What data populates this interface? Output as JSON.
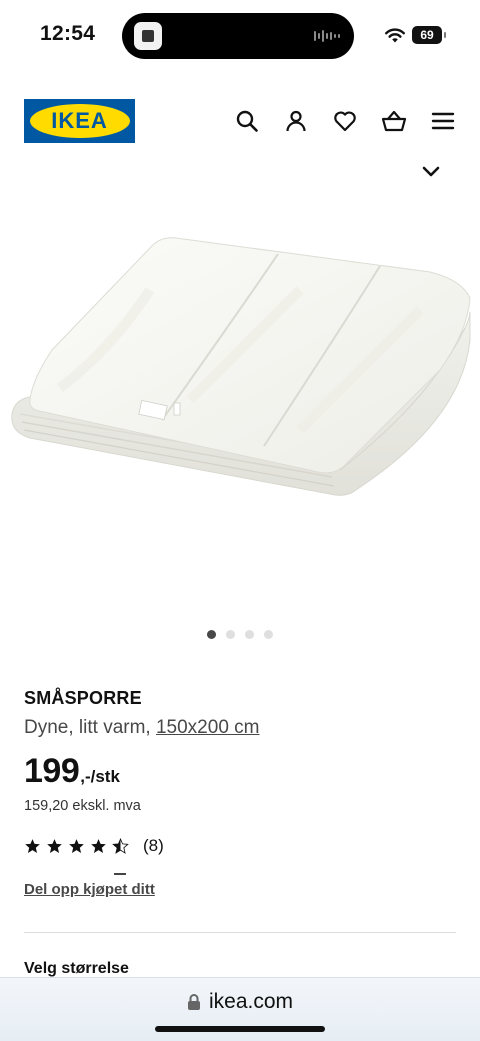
{
  "status_bar": {
    "time": "12:54",
    "battery": "69"
  },
  "header": {
    "logo_text": "IKEA",
    "icons": [
      "search-icon",
      "account-icon",
      "heart-icon",
      "basket-icon",
      "menu-icon"
    ]
  },
  "product": {
    "image_icon": "duvet-image",
    "carousel_count": 4,
    "carousel_active_index": 0,
    "name": "SMÅSPORRE",
    "description": "Dyne, litt varm,",
    "size": "150x200 cm",
    "price": "199",
    "price_unit": ",-/stk",
    "price_ex_vat": "159,20 ekskl. mva",
    "rating": 4.5,
    "rating_max": 5,
    "review_count": "(8)",
    "split_payment_link": "Del opp kjøpet ditt",
    "choose_size_heading": "Velg størrelse"
  },
  "browser": {
    "url": "ikea.com",
    "lock_icon": "lock-icon"
  },
  "colors": {
    "ikea_blue": "#0058a3",
    "ikea_yellow": "#ffdb00",
    "text": "#111111",
    "muted": "#484848"
  }
}
